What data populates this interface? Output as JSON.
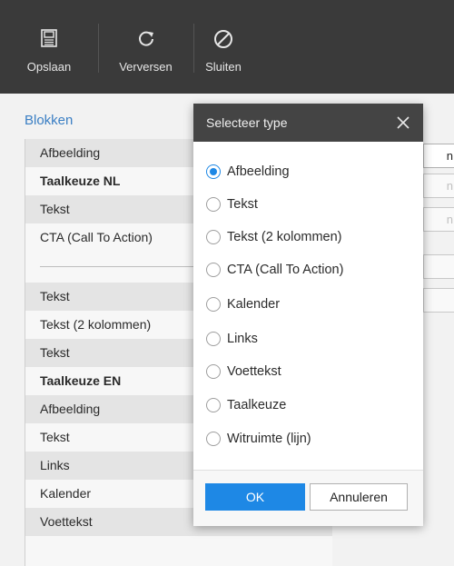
{
  "toolbar": {
    "save_label": "Opslaan",
    "refresh_label": "Verversen",
    "close_label": "Sluiten"
  },
  "panel": {
    "title": "Blokken",
    "items_group1": [
      {
        "label": "Afbeelding",
        "bold": false
      },
      {
        "label": "Taalkeuze NL",
        "bold": true
      },
      {
        "label": "Tekst",
        "bold": false
      },
      {
        "label": "CTA (Call To Action)",
        "bold": false
      }
    ],
    "items_group2": [
      {
        "label": "Tekst",
        "bold": false
      },
      {
        "label": "Tekst (2 kolommen)",
        "bold": false
      },
      {
        "label": "Tekst",
        "bold": false
      },
      {
        "label": "Taalkeuze EN",
        "bold": true
      },
      {
        "label": "Afbeelding",
        "bold": false
      },
      {
        "label": "Tekst",
        "bold": false
      },
      {
        "label": "Links",
        "bold": false
      },
      {
        "label": "Kalender",
        "bold": false
      },
      {
        "label": "Voettekst",
        "bold": false
      }
    ]
  },
  "right_column": {
    "stub_glyph": "n"
  },
  "dialog": {
    "title": "Selecteer type",
    "selected_index": 0,
    "options": [
      "Afbeelding",
      "Tekst",
      "Tekst (2 kolommen)",
      "CTA (Call To Action)",
      "Kalender",
      "Links",
      "Voettekst",
      "Taalkeuze",
      "Witruimte (lijn)"
    ],
    "ok_label": "OK",
    "cancel_label": "Annuleren"
  },
  "colors": {
    "accent": "#1e88e5",
    "toolbar_bg": "#3a3a3a",
    "dialog_header_bg": "#444444",
    "panel_title": "#3b7fc4"
  }
}
